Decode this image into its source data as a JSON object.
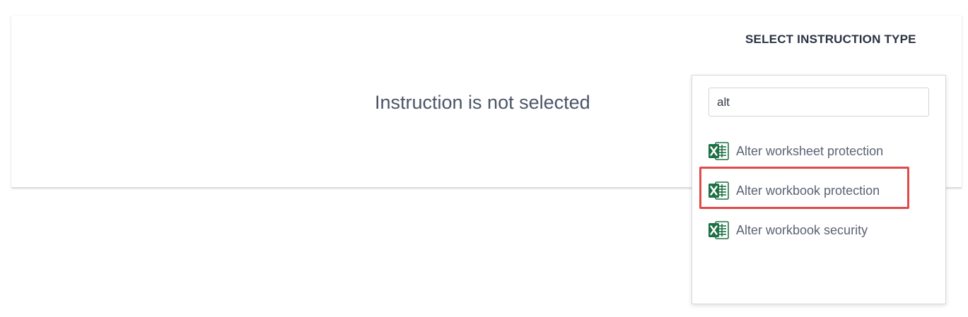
{
  "main": {
    "empty_message": "Instruction is not selected"
  },
  "picker": {
    "title": "SELECT INSTRUCTION TYPE",
    "search": {
      "value": "alt",
      "placeholder": ""
    },
    "options": [
      {
        "label": "Alter worksheet protection",
        "icon": "excel-icon"
      },
      {
        "label": "Alter workbook protection",
        "icon": "excel-icon",
        "highlighted": true
      },
      {
        "label": "Alter workbook security",
        "icon": "excel-icon"
      }
    ]
  },
  "colors": {
    "excel_green": "#1e7145",
    "highlight_red": "#e24a4a",
    "text_primary": "#2a3242",
    "text_secondary": "#5a6374"
  }
}
